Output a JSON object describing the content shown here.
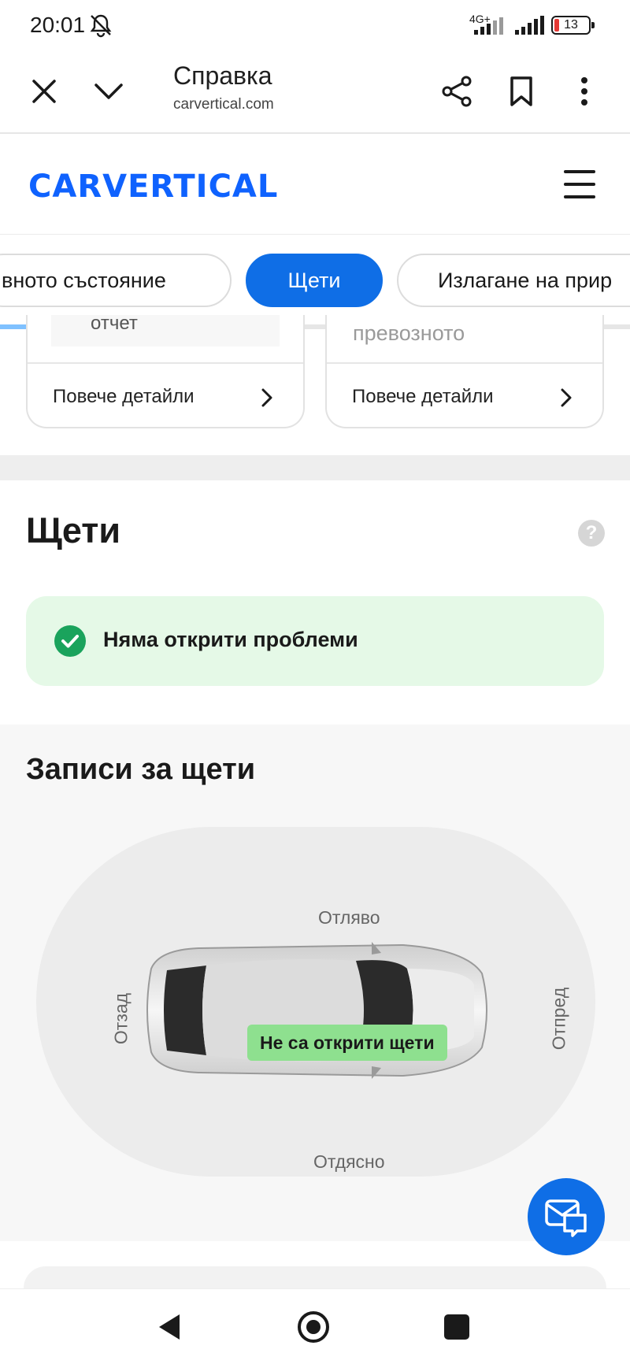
{
  "status_bar": {
    "time": "20:01",
    "network": "4G+",
    "battery": "13",
    "icons": [
      "bell-muted-icon",
      "signal-icon",
      "signal-icon",
      "battery-icon"
    ]
  },
  "browser": {
    "title": "Справка",
    "domain": "carvertical.com",
    "icons": [
      "close-icon",
      "chevron-down-icon",
      "share-icon",
      "bookmark-icon",
      "more-vertical-icon"
    ]
  },
  "site": {
    "logo": "CARVERTICAL",
    "menu_icon": "hamburger-icon"
  },
  "tabs": [
    {
      "label": "вното състояние",
      "active": false
    },
    {
      "label": "Щети",
      "active": true
    },
    {
      "label": "Излагане на прир",
      "active": false
    }
  ],
  "tabs_progress": 0.41,
  "cards": [
    {
      "top_text": "отчет",
      "link": "Повече детайли"
    },
    {
      "top_text": "превозното",
      "link": "Повече детайли"
    }
  ],
  "damages": {
    "title": "Щети",
    "help": "?",
    "status": "Няма открити проблеми"
  },
  "records": {
    "title": "Записи за щети",
    "labels": {
      "left": "Отляво",
      "right": "Отдясно",
      "rear": "Отзад",
      "front": "Отпред"
    },
    "badge": "Не са открити щети"
  },
  "colors": {
    "brand": "#0f6ee6",
    "success_bg": "#e5f9e7",
    "success_icon": "#1aa35c",
    "badge_green": "#8ee08f"
  }
}
